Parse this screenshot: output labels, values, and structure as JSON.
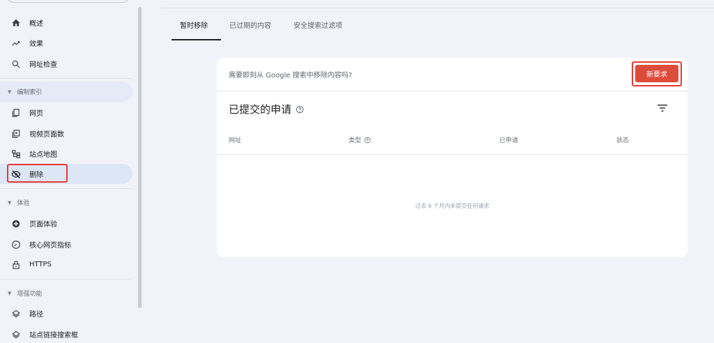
{
  "sidebar": {
    "items": [
      {
        "label": "概述",
        "icon": "home-icon"
      },
      {
        "label": "效果",
        "icon": "trending-up-icon"
      },
      {
        "label": "网址检查",
        "icon": "search-icon"
      }
    ],
    "sections": [
      {
        "title": "编制索引",
        "items": [
          {
            "label": "网页",
            "icon": "pages-icon"
          },
          {
            "label": "视频页面数",
            "icon": "video-page-icon"
          },
          {
            "label": "站点地图",
            "icon": "sitemap-icon"
          },
          {
            "label": "删除",
            "icon": "eye-off-icon"
          }
        ]
      },
      {
        "title": "体验",
        "items": [
          {
            "label": "页面体验",
            "icon": "page-experience-icon"
          },
          {
            "label": "核心网页指标",
            "icon": "gauge-icon"
          },
          {
            "label": "HTTPS",
            "icon": "lock-icon"
          }
        ]
      },
      {
        "title": "增强功能",
        "items": [
          {
            "label": "路径",
            "icon": "layers-icon"
          },
          {
            "label": "站点链接搜索框",
            "icon": "layers-icon"
          }
        ]
      }
    ]
  },
  "tabs": [
    {
      "label": "暂时移除",
      "active": true
    },
    {
      "label": "已过期的内容",
      "active": false
    },
    {
      "label": "安全搜索过滤项",
      "active": false
    }
  ],
  "card": {
    "question": "需要即刻从 Google 搜索中移除内容吗?",
    "new_request_label": "新要求",
    "title": "已提交的申请",
    "columns": [
      "网址",
      "类型",
      "已申请",
      "状态"
    ],
    "empty_message": "过去 6 个月内未提交任何请求"
  },
  "colors": {
    "accent_red": "#dd4b39",
    "annotation_red": "#e53935",
    "active_nav_bg": "#dde6f5",
    "page_bg": "#f1f3f8"
  }
}
